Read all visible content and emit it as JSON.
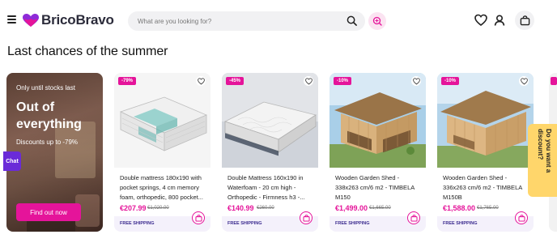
{
  "header": {
    "brand": "BricoBravo",
    "search_placeholder": "What are you looking for?",
    "icons": [
      "menu-icon",
      "search-icon",
      "visual-search-icon",
      "heart-icon",
      "user-icon",
      "cart-icon"
    ]
  },
  "section_title": "Last chances of the summer",
  "promo": {
    "kicker": "Only until stocks last",
    "headline": "Out of everything",
    "subtext": "Discounts up to -79%",
    "button": "Find out now"
  },
  "chat_label": "Chat",
  "discount_tab": "Do you want a\ndiscount?",
  "products": [
    {
      "badge": "-79%",
      "name": "Double mattress 180x190 with pocket springs, 4 cm memory foam, orthopedic, 800 pocket...",
      "price": "€207.99",
      "old_price": "€1,020.00",
      "shipping": "FREE SHIPPING"
    },
    {
      "badge": "-45%",
      "name": "Double Mattress 160x190 in Waterfoam - 20 cm high - Orthopedic - Firmness h3 -...",
      "price": "€140.99",
      "old_price": "€260.00",
      "shipping": "FREE SHIPPING"
    },
    {
      "badge": "-10%",
      "name": "Wooden Garden Shed - 338x263 cm/6 m2 - TIMBELA M150",
      "price": "€1,499.00",
      "old_price": "€1,665.00",
      "shipping": "FREE SHIPPING"
    },
    {
      "badge": "-10%",
      "name": "Wooden Garden Shed - 336x263 cm/6 m2 - TIMBELA M150B",
      "price": "€1,588.00",
      "old_price": "€1,765.00",
      "shipping": "FREE SHIPPING"
    }
  ],
  "colors": {
    "accent": "#e5149a",
    "brand_purple": "#6a2bd8",
    "shipping_text": "#3b2b8f"
  }
}
